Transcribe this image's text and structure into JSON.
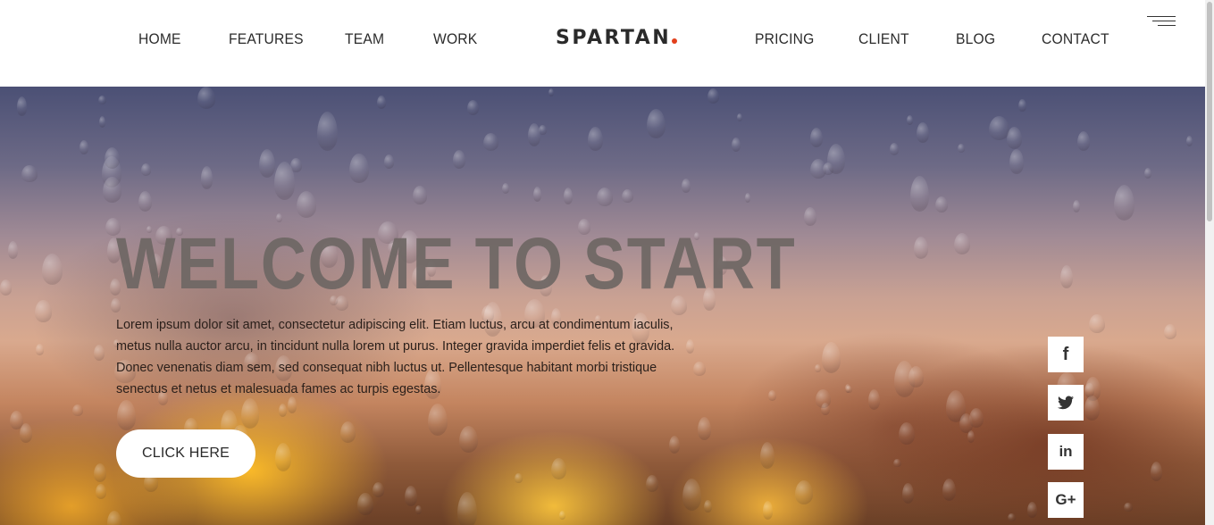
{
  "nav": {
    "left": [
      "HOME",
      "FEATURES",
      "TEAM",
      "WORK"
    ],
    "right": [
      "PRICING",
      "CLIENT",
      "BLOG",
      "CONTACT"
    ],
    "logo": "SPARTAN",
    "logo_dot_color": "#e2401c",
    "menu_icon": "hamburger-menu-icon"
  },
  "hero": {
    "title": "WELCOME TO START",
    "text": "Lorem ipsum dolor sit amet, consectetur adipiscing elit. Etiam luctus, arcu at condimentum iaculis, metus nulla auctor arcu, in tincidunt nulla lorem ut purus. Integer gravida imperdiet felis et gravida. Donec venenatis diam sem, sed consequat nibh luctus ut. Pellentesque habitant morbi tristique senectus et netus et malesuada fames ac turpis egestas.",
    "button_label": "CLICK HERE"
  },
  "social": [
    {
      "icon": "facebook-icon",
      "glyph": "f"
    },
    {
      "icon": "twitter-icon",
      "glyph": "🐦"
    },
    {
      "icon": "linkedin-icon",
      "glyph": "in"
    },
    {
      "icon": "google-plus-icon",
      "glyph": "G+"
    }
  ]
}
